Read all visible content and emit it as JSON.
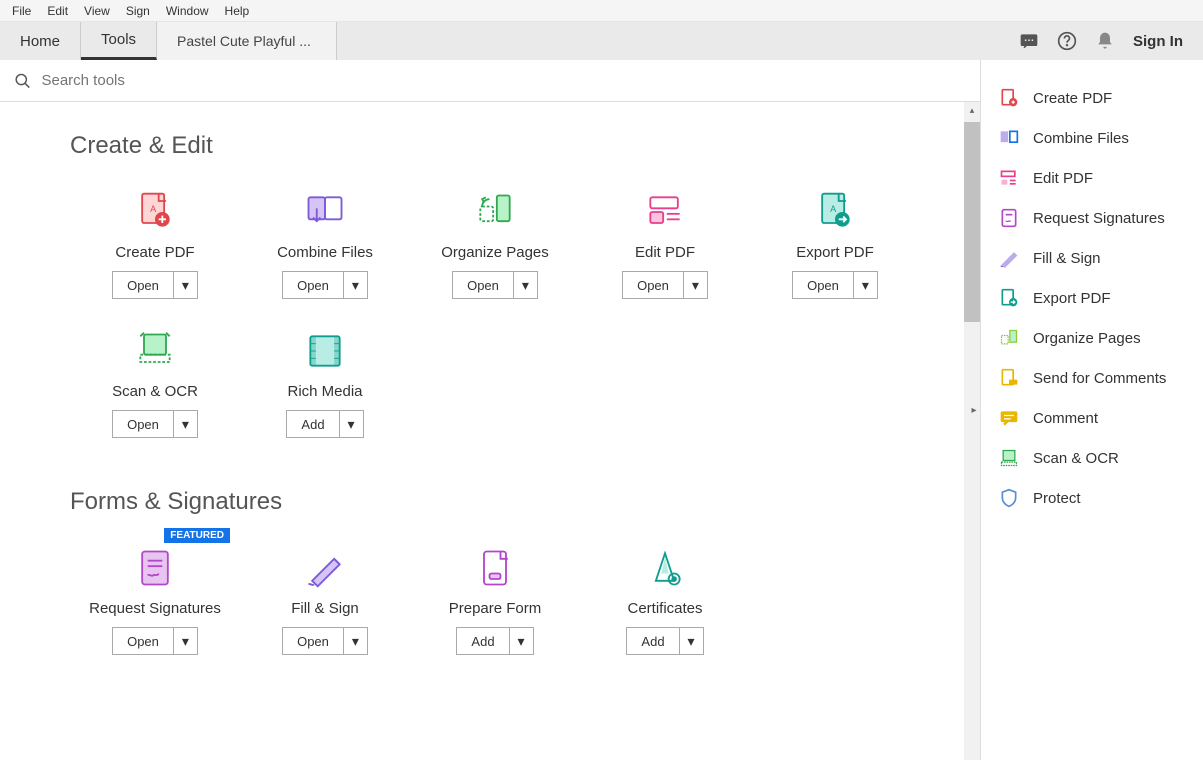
{
  "menu": {
    "items": [
      "File",
      "Edit",
      "View",
      "Sign",
      "Window",
      "Help"
    ]
  },
  "tabs": {
    "home": "Home",
    "tools": "Tools",
    "doc": "Pastel Cute Playful ..."
  },
  "header": {
    "signin": "Sign In"
  },
  "search": {
    "placeholder": "Search tools"
  },
  "sections": {
    "create_edit": {
      "title": "Create & Edit",
      "tools": [
        {
          "label": "Create PDF",
          "action": "Open"
        },
        {
          "label": "Combine Files",
          "action": "Open"
        },
        {
          "label": "Organize Pages",
          "action": "Open"
        },
        {
          "label": "Edit PDF",
          "action": "Open"
        },
        {
          "label": "Export PDF",
          "action": "Open"
        },
        {
          "label": "Scan & OCR",
          "action": "Open"
        },
        {
          "label": "Rich Media",
          "action": "Add"
        }
      ]
    },
    "forms": {
      "title": "Forms & Signatures",
      "tools": [
        {
          "label": "Request Signatures",
          "action": "Open",
          "featured": "FEATURED"
        },
        {
          "label": "Fill & Sign",
          "action": "Open"
        },
        {
          "label": "Prepare Form",
          "action": "Add"
        },
        {
          "label": "Certificates",
          "action": "Add"
        }
      ]
    }
  },
  "sidebar": {
    "items": [
      "Create PDF",
      "Combine Files",
      "Edit PDF",
      "Request Signatures",
      "Fill & Sign",
      "Export PDF",
      "Organize Pages",
      "Send for Comments",
      "Comment",
      "Scan & OCR",
      "Protect"
    ]
  }
}
